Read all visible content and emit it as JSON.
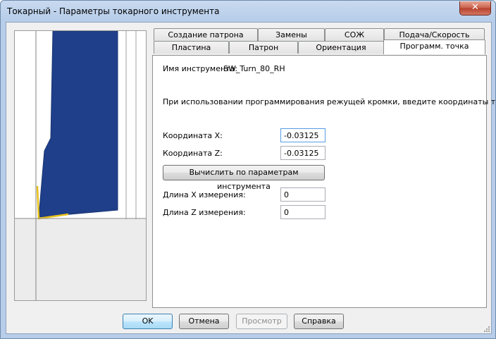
{
  "window": {
    "title": "Токарный - Параметры токарного инструмента",
    "close_glyph": "✕"
  },
  "tabs": {
    "row_back": [
      "Создание патрона",
      "Замены",
      "СОЖ",
      "Подача/Скорость"
    ],
    "row_front": [
      "Пластина",
      "Патрон",
      "Ориентация",
      "Программ. точка"
    ],
    "active": "Программ. точка"
  },
  "panel": {
    "tool_name_label": "Имя инструмента:",
    "tool_name_value": "SW_Turn_80_RH",
    "instruction": "При использовании программирования режущей кромки, введите координаты точки:",
    "coord_x_label": "Координата X:",
    "coord_x_value": "-0.03125",
    "coord_z_label": "Координата Z:",
    "coord_z_value": "-0.03125",
    "compute_button": "Вычислить по параметрам инструмента",
    "length_x_label": "Длина X измерения:",
    "length_x_value": "0",
    "length_z_label": "Длина Z измерения:",
    "length_z_value": "0"
  },
  "buttons": {
    "ok": "OK",
    "cancel": "Отмена",
    "preview": "Просмотр",
    "help": "Справка"
  },
  "colors": {
    "tool_body": "#1f3f8a",
    "insert_edge": "#e8c21a",
    "accent": "#3c7fb1"
  }
}
